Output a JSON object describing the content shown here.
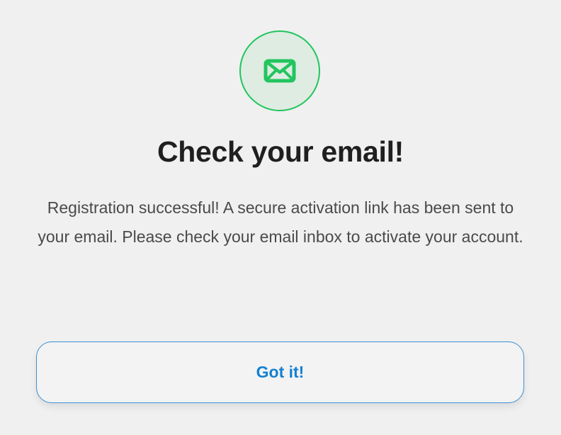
{
  "icon": {
    "name": "envelope-icon",
    "color": "#22c55e",
    "background": "#dfece2"
  },
  "title": "Check your email!",
  "message": "Registration successful! A secure activation link has been sent to your email. Please check your email inbox to activate your account.",
  "button": {
    "label": "Got it!",
    "color": "#1580d0"
  }
}
